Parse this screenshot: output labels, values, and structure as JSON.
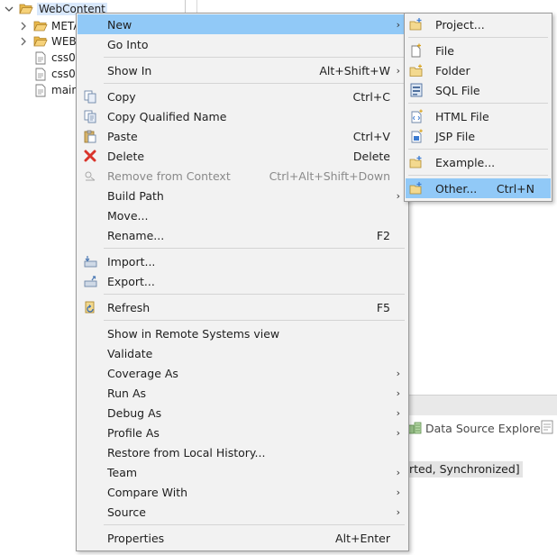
{
  "explorer": {
    "root_label": "WebContent",
    "items": [
      {
        "label": "META"
      },
      {
        "label": "WEB"
      },
      {
        "label": "css0"
      },
      {
        "label": "css0"
      },
      {
        "label": "main"
      }
    ]
  },
  "background_panel": {
    "tab_label": "Data Source Explorer",
    "status_text": "rted, Synchronized]"
  },
  "context_menu": {
    "new": {
      "label": "New"
    },
    "go_into": {
      "label": "Go Into"
    },
    "show_in": {
      "label": "Show In",
      "shortcut": "Alt+Shift+W"
    },
    "copy": {
      "label": "Copy",
      "shortcut": "Ctrl+C"
    },
    "copy_qualified": {
      "label": "Copy Qualified Name"
    },
    "paste": {
      "label": "Paste",
      "shortcut": "Ctrl+V"
    },
    "delete": {
      "label": "Delete",
      "shortcut": "Delete"
    },
    "remove_context": {
      "label": "Remove from Context",
      "shortcut": "Ctrl+Alt+Shift+Down"
    },
    "build_path": {
      "label": "Build Path"
    },
    "move": {
      "label": "Move..."
    },
    "rename": {
      "label": "Rename...",
      "shortcut": "F2"
    },
    "import": {
      "label": "Import..."
    },
    "export": {
      "label": "Export..."
    },
    "refresh": {
      "label": "Refresh",
      "shortcut": "F5"
    },
    "show_remote": {
      "label": "Show in Remote Systems view"
    },
    "validate": {
      "label": "Validate"
    },
    "coverage_as": {
      "label": "Coverage As"
    },
    "run_as": {
      "label": "Run As"
    },
    "debug_as": {
      "label": "Debug As"
    },
    "profile_as": {
      "label": "Profile As"
    },
    "restore_history": {
      "label": "Restore from Local History..."
    },
    "team": {
      "label": "Team"
    },
    "compare_with": {
      "label": "Compare With"
    },
    "source": {
      "label": "Source"
    },
    "properties": {
      "label": "Properties",
      "shortcut": "Alt+Enter"
    }
  },
  "new_submenu": {
    "project": {
      "label": "Project..."
    },
    "file": {
      "label": "File"
    },
    "folder": {
      "label": "Folder"
    },
    "sql_file": {
      "label": "SQL File"
    },
    "html_file": {
      "label": "HTML File"
    },
    "jsp_file": {
      "label": "JSP File"
    },
    "example": {
      "label": "Example..."
    },
    "other": {
      "label": "Other...",
      "shortcut": "Ctrl+N"
    }
  },
  "colors": {
    "menu_background": "#f2f2f2",
    "highlight": "#91c9f7",
    "disabled_text": "#8a8a8a",
    "delete_icon": "#d9342b"
  }
}
